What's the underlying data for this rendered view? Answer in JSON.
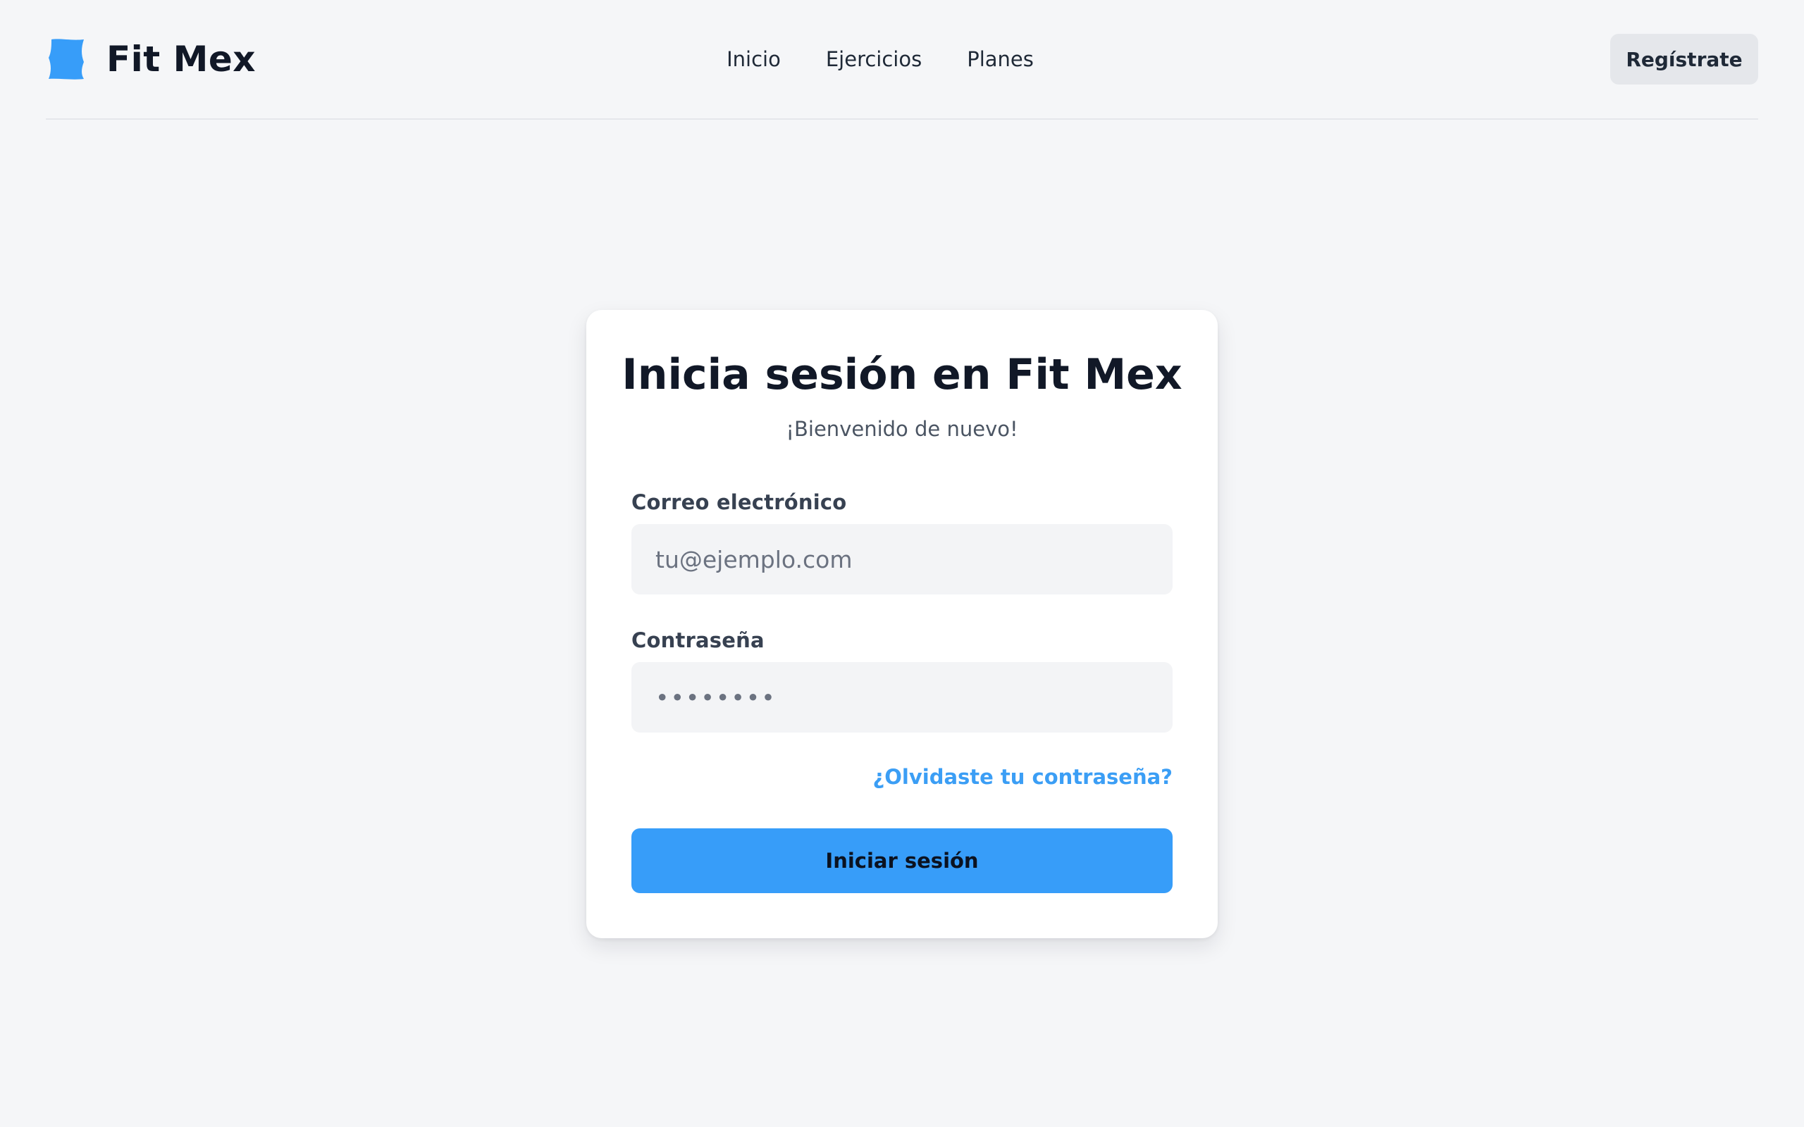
{
  "header": {
    "brand_name": "Fit Mex",
    "brand_icon": "fit-mex-logo-icon",
    "nav": [
      {
        "label": "Inicio"
      },
      {
        "label": "Ejercicios"
      },
      {
        "label": "Planes"
      }
    ],
    "register_label": "Regístrate"
  },
  "login": {
    "title": "Inicia sesión en Fit Mex",
    "subtitle": "¡Bienvenido de nuevo!",
    "email_label": "Correo electrónico",
    "email_placeholder": "tu@ejemplo.com",
    "password_label": "Contraseña",
    "password_value": "••••••••",
    "forgot_label": "¿Olvidaste tu contraseña?",
    "submit_label": "Iniciar sesión"
  },
  "colors": {
    "accent": "#379df9",
    "link": "#3b9ef5",
    "background": "#f5f6f8"
  }
}
